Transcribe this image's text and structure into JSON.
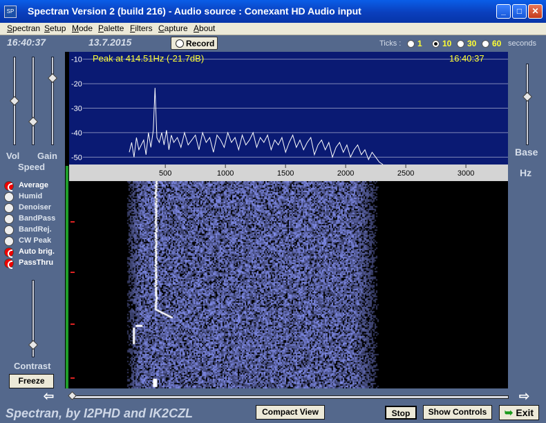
{
  "window": {
    "title": "Spectran Version 2 (build 216) - Audio source  :  Conexant HD Audio input",
    "icon": "app-icon",
    "icon_text": "SP",
    "min_glyph": "_",
    "max_glyph": "□",
    "close_glyph": "✕"
  },
  "menu": [
    "Spectran",
    "Setup",
    "Mode",
    "Palette",
    "Filters",
    "Capture",
    "About"
  ],
  "header": {
    "time": "16:40:37",
    "date": "13.7.2015",
    "record_label": "Record",
    "ticks_label": "Ticks :",
    "ticks_options": [
      "1",
      "10",
      "30",
      "60"
    ],
    "ticks_selected": "10",
    "ticks_unit": "seconds"
  },
  "controls": {
    "vol_label": "Vol",
    "gain_label": "Gain",
    "speed_label": "Speed",
    "vol_level": 0.5,
    "speed_level": 0.25,
    "gain_level": 0.78,
    "base_label": "Base",
    "hz_label": "Hz",
    "base_level": 0.6,
    "contrast_label": "Contrast",
    "contrast_level": 0.13,
    "freeze_label": "Freeze"
  },
  "options": [
    {
      "label": "Average",
      "on": true
    },
    {
      "label": "Humid",
      "on": false
    },
    {
      "label": "Denoiser",
      "on": false
    },
    {
      "label": "BandPass",
      "on": false
    },
    {
      "label": "BandRej.",
      "on": false
    },
    {
      "label": "CW Peak",
      "on": false
    },
    {
      "label": "Auto brig.",
      "on": true
    },
    {
      "label": "PassThru",
      "on": true
    }
  ],
  "spectrum": {
    "peak_text": "Peak at   414.51Hz (-21.7dB)",
    "time": "16:40:37",
    "colors": {
      "background": "#0a1a73",
      "trace": "#ffffff",
      "label": "#ffff33",
      "grid": "#8088b8"
    }
  },
  "chart_data": {
    "type": "line",
    "xlabel": "",
    "ylabel": "",
    "xlim": [
      -300,
      3350
    ],
    "ylim": [
      -53,
      -7
    ],
    "y_ticks": [
      -10,
      -20,
      -30,
      -40,
      -50
    ],
    "x_ticks": [
      500,
      1000,
      1500,
      2000,
      2500,
      3000
    ],
    "peak": {
      "x": 414.51,
      "y": -21.7
    },
    "series": [
      {
        "x": [
          200,
          220,
          240,
          260,
          280,
          300,
          320,
          340,
          360,
          380,
          400,
          414.51,
          430,
          450,
          470,
          490,
          510,
          530,
          550,
          570,
          600,
          630,
          660,
          690,
          720,
          750,
          780,
          810,
          840,
          870,
          900,
          930,
          960,
          990,
          1020,
          1050,
          1080,
          1110,
          1140,
          1170,
          1200,
          1230,
          1260,
          1290,
          1320,
          1350,
          1380,
          1410,
          1440,
          1470,
          1500,
          1530,
          1560,
          1590,
          1620,
          1650,
          1680,
          1710,
          1740,
          1770,
          1800,
          1830,
          1860,
          1890,
          1920,
          1950,
          1980,
          2010,
          2040,
          2070,
          2100,
          2130,
          2160,
          2190,
          2220,
          2250,
          2280,
          2310
        ],
        "y": [
          -48,
          -44,
          -50,
          -42,
          -47,
          -45,
          -43,
          -49,
          -40,
          -46,
          -39,
          -21.7,
          -42,
          -44,
          -40,
          -45,
          -39,
          -47,
          -41,
          -44,
          -42,
          -46,
          -40,
          -45,
          -43,
          -41,
          -47,
          -40,
          -44,
          -42,
          -48,
          -41,
          -43,
          -46,
          -40,
          -44,
          -42,
          -47,
          -41,
          -45,
          -43,
          -40,
          -46,
          -42,
          -44,
          -41,
          -47,
          -43,
          -45,
          -42,
          -48,
          -44,
          -41,
          -46,
          -43,
          -47,
          -44,
          -42,
          -49,
          -45,
          -43,
          -47,
          -44,
          -50,
          -46,
          -44,
          -48,
          -45,
          -50,
          -47,
          -45,
          -49,
          -47,
          -51,
          -48,
          -50,
          -52,
          -53
        ]
      }
    ]
  },
  "waterfall": {
    "trace_freq": 414.51,
    "band_end_freq": 2300
  },
  "footer": {
    "credit": "Spectran, by I2PHD and IK2CZL",
    "compact_label": "Compact View",
    "stop_label": "Stop",
    "show_controls_label": "Show Controls",
    "exit_label": "Exit",
    "left_arrow": "⇦",
    "right_arrow": "⇨"
  }
}
